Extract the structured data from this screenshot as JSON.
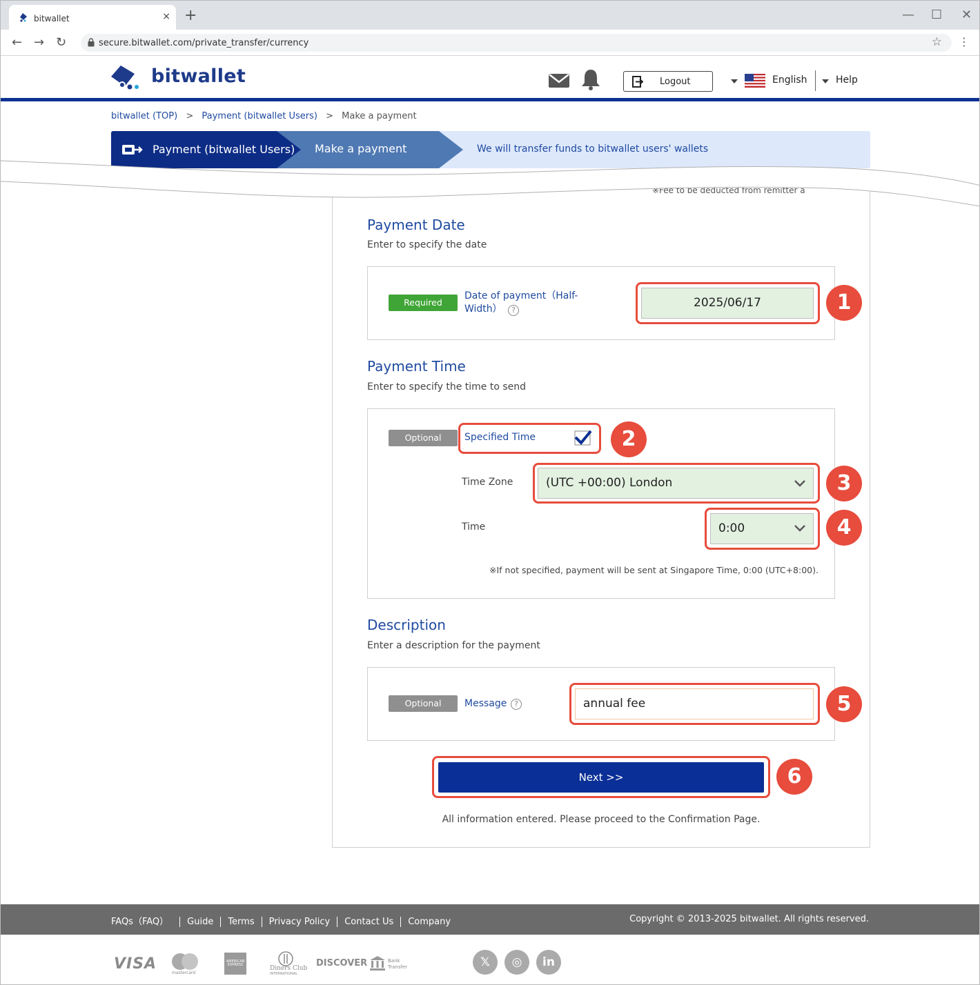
{
  "browser": {
    "tab_title": "bitwallet",
    "tab_close": "×",
    "new_tab": "+",
    "url": "secure.bitwallet.com/private_transfer/currency",
    "back": "←",
    "forward": "→",
    "reload": "↻",
    "bookmark": "☆",
    "menu": "⋮",
    "minimize": "—",
    "maximize": "☐",
    "close": "✕"
  },
  "header": {
    "brand": "bitwallet",
    "logout": "Logout",
    "language": "English",
    "help": "Help"
  },
  "breadcrumb": {
    "home": "bitwallet (TOP)",
    "sep1": ">",
    "section": "Payment (bitwallet Users)",
    "sep2": ">",
    "current": "Make a payment"
  },
  "banner": {
    "section": "Payment (bitwallet Users)",
    "step": "Make a payment",
    "description": "We will transfer funds to bitwallet users' wallets"
  },
  "fee_note": "※Fee to be deducted from remitter a",
  "payment_date": {
    "title": "Payment Date",
    "subtitle": "Enter to specify the date",
    "badge": "Required",
    "label_line1": "Date of payment（Half-",
    "label_line2": "Width）",
    "help": "?",
    "value": "2025/06/17"
  },
  "payment_time": {
    "title": "Payment Time",
    "subtitle": "Enter to specify the time to send",
    "badge": "Optional",
    "specified_label": "Specified Time",
    "specified_checked": true,
    "timezone_label": "Time Zone",
    "timezone_value": "(UTC +00:00) London",
    "time_label": "Time",
    "time_value": "0:00",
    "note": "※If not specified, payment will be sent at Singapore Time, 0:00 (UTC+8:00)."
  },
  "description": {
    "title": "Description",
    "subtitle": "Enter a description for the payment",
    "badge": "Optional",
    "label": "Message",
    "help": "?",
    "value": "annual fee"
  },
  "next_button": "Next >>",
  "proceed_text": "All information entered. Please proceed to the Confirmation Page.",
  "callouts": [
    "1",
    "2",
    "3",
    "4",
    "5",
    "6"
  ],
  "footer": {
    "links": [
      "FAQs（FAQ）",
      "Guide",
      "Terms",
      "Privacy Policy",
      "Contact Us",
      "Company"
    ],
    "copyright": "Copyright © 2013-2025 bitwallet. All rights reserved."
  },
  "payment_methods": {
    "visa": "VISA",
    "mastercard": "mastercard",
    "amex": "AMERICAN EXPRESS",
    "diners": "Diners Club",
    "diners_sub": "INTERNATIONAL",
    "discover": "DISCOVER",
    "bank_line1": "Bank",
    "bank_line2": "Transfer"
  },
  "social": {
    "x": "𝕏",
    "instagram": "◎",
    "linkedin": "in"
  },
  "colors": {
    "brand_navy": "#0d3192",
    "link_blue": "#1f4aa0",
    "required_green": "#3fa536",
    "optional_gray": "#8f8f8f",
    "highlight_red": "#e74c3c",
    "field_green": "#e3f1e1",
    "next_button": "#0a2f96"
  }
}
